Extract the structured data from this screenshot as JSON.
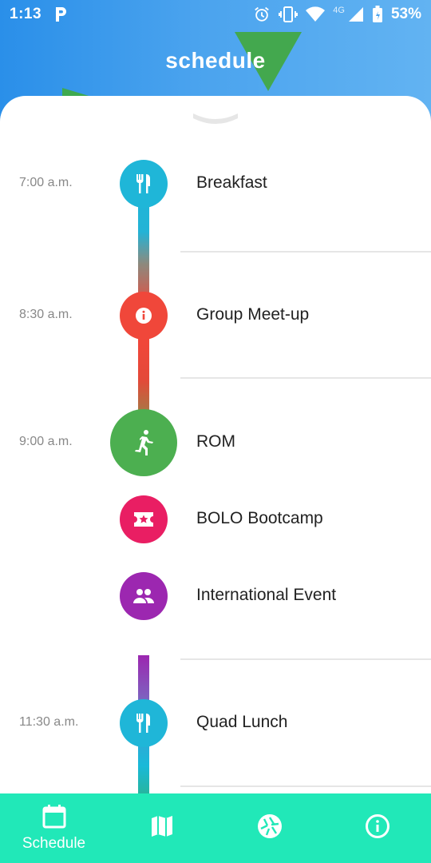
{
  "status_bar": {
    "time": "1:13",
    "app_icon": "p-icon",
    "network": "4G",
    "battery": "53%"
  },
  "header": {
    "title": "schedule"
  },
  "events": [
    {
      "time": "7:00 a.m.",
      "title": "Breakfast",
      "icon": "restaurant-icon",
      "color": "#1fb6d8"
    },
    {
      "time": "8:30 a.m.",
      "title": "Group Meet-up",
      "icon": "info-icon",
      "color": "#f0473a"
    },
    {
      "time": "9:00 a.m.",
      "title": "ROM",
      "icon": "run-icon",
      "color": "#4caf50"
    },
    {
      "time": "",
      "title": "BOLO Bootcamp",
      "icon": "ticket-icon",
      "color": "#e91e63"
    },
    {
      "time": "",
      "title": "International Event",
      "icon": "group-icon",
      "color": "#9c27b0"
    },
    {
      "time": "11:30 a.m.",
      "title": "Quad Lunch",
      "icon": "restaurant-icon",
      "color": "#1fb6d8"
    }
  ],
  "bottom_nav": {
    "items": [
      {
        "label": "Schedule",
        "icon": "calendar-icon",
        "active": true
      },
      {
        "label": "",
        "icon": "map-icon",
        "active": false
      },
      {
        "label": "",
        "icon": "shutter-icon",
        "active": false
      },
      {
        "label": "",
        "icon": "info-icon",
        "active": false
      }
    ],
    "color": "#21e8b8"
  },
  "theme": {
    "header_blue": "#4aa3ee",
    "accent_green": "#43a84e"
  }
}
